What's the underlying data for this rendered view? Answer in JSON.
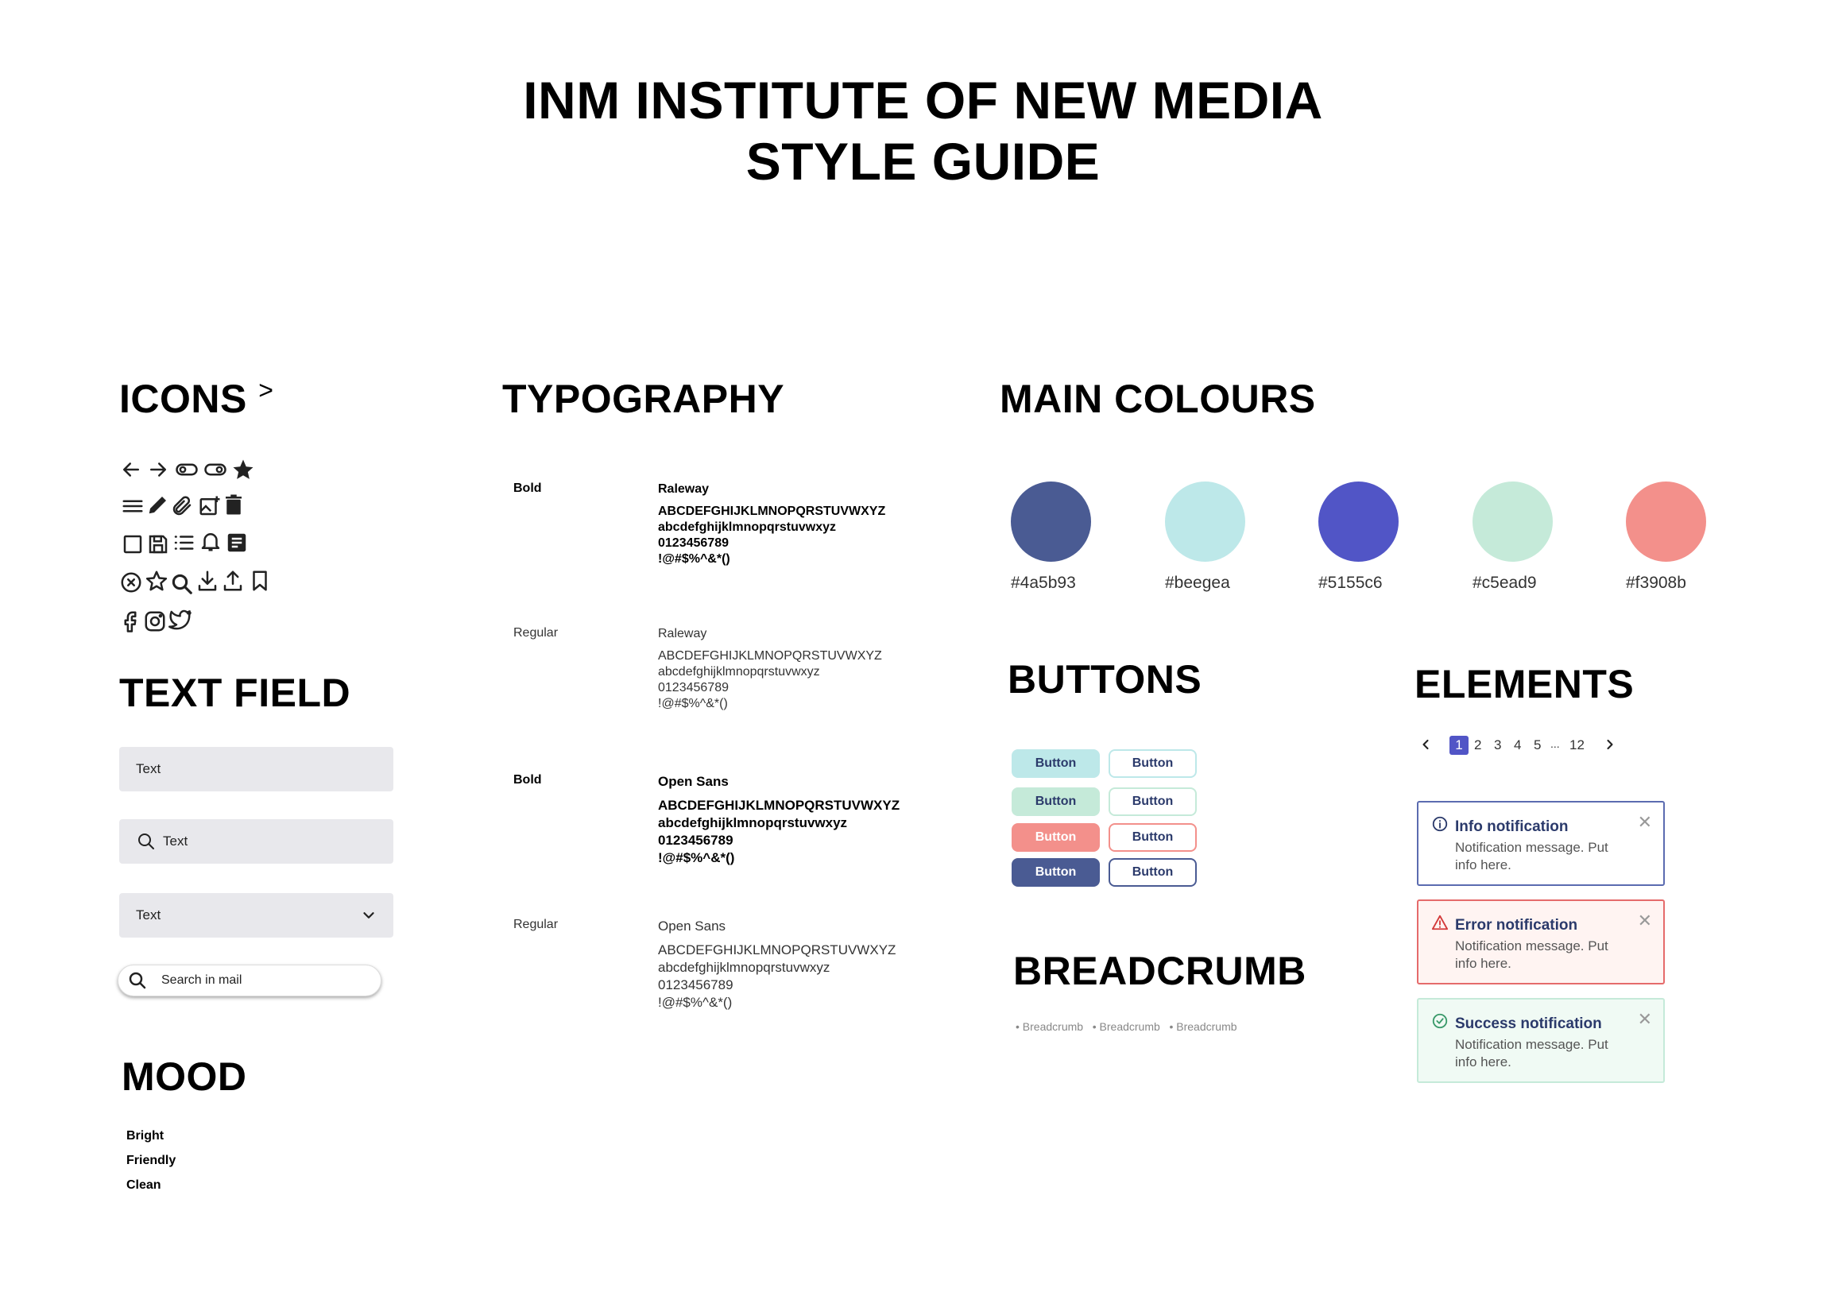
{
  "title": {
    "line1": "INM INSTITUTE OF NEW MEDIA",
    "line2": "STYLE GUIDE"
  },
  "icons": {
    "heading": "ICONS",
    "heading_suffix": ">",
    "rows": [
      [
        "arrow-left-icon",
        "arrow-right-icon",
        "toggle-off-icon",
        "toggle-on-icon",
        "star-filled-icon"
      ],
      [
        "menu-icon",
        "pencil-icon",
        "paperclip-icon",
        "add-image-icon",
        "trash-icon"
      ],
      [
        "checkbox-icon",
        "save-icon",
        "list-icon",
        "bell-icon",
        "notes-icon"
      ],
      [
        "close-circle-icon",
        "star-outline-icon",
        "search-icon",
        "download-icon",
        "upload-icon",
        "bookmark-icon"
      ],
      [
        "facebook-icon",
        "instagram-icon",
        "twitter-icon"
      ]
    ]
  },
  "text_field": {
    "heading": "TEXT FIELD",
    "plain_value": "Text",
    "search_value": "Text",
    "select_value": "Text",
    "mail_search_placeholder": "Search in mail"
  },
  "mood": {
    "heading": "MOOD",
    "items": [
      "Bright",
      "Friendly",
      "Clean"
    ]
  },
  "typography": {
    "heading": "TYPOGRAPHY",
    "samples": [
      {
        "weight": "Bold",
        "font": "Raleway",
        "upper": "ABCDEFGHIJKLMNOPQRSTUVWXYZ",
        "lower": "abcdefghijklmnopqrstuvwxyz",
        "digits": "0123456789",
        "symbols": "!@#$%^&*()"
      },
      {
        "weight": "Regular",
        "font": "Raleway",
        "upper": "ABCDEFGHIJKLMNOPQRSTUVWXYZ",
        "lower": "abcdefghijklmnopqrstuvwxyz",
        "digits": "0123456789",
        "symbols": "!@#$%^&*()"
      },
      {
        "weight": "Bold",
        "font": "Open Sans",
        "upper": "ABCDEFGHIJKLMNOPQRSTUVWXYZ",
        "lower": "abcdefghijklmnopqrstuvwxyz",
        "digits": "0123456789",
        "symbols": "!@#$%^&*()"
      },
      {
        "weight": "Regular",
        "font": "Open Sans",
        "upper": "ABCDEFGHIJKLMNOPQRSTUVWXYZ",
        "lower": "abcdefghijklmnopqrstuvwxyz",
        "digits": "0123456789",
        "symbols": "!@#$%^&*()"
      }
    ]
  },
  "colours": {
    "heading": "MAIN COLOURS",
    "swatches": [
      {
        "hex": "#4a5b93",
        "label": "#4a5b93"
      },
      {
        "hex": "#beegea",
        "css": "#bde8e9",
        "label": "#beegea"
      },
      {
        "hex": "#5155c6",
        "label": "#5155c6"
      },
      {
        "hex": "#c5ead9",
        "css": "#c5ead9",
        "label": "#c5ead9"
      },
      {
        "hex": "#f3908b",
        "label": "#f3908b"
      }
    ]
  },
  "buttons": {
    "heading": "BUTTONS",
    "label": "Button",
    "rows": [
      {
        "fill": "#bde8e9",
        "outline": "#bde8e9"
      },
      {
        "fill": "#c5ead9",
        "outline": "#c5ead9"
      },
      {
        "fill": "#f3908b",
        "outline": "#f3908b"
      },
      {
        "fill": "#4a5b93",
        "outline": "#4a5b93"
      }
    ]
  },
  "breadcrumb": {
    "heading": "BREADCRUMB",
    "items": [
      "Breadcrumb",
      "Breadcrumb",
      "Breadcrumb"
    ]
  },
  "elements": {
    "heading": "ELEMENTS",
    "pagination": {
      "pages": [
        "1",
        "2",
        "3",
        "4",
        "5",
        "...",
        "12"
      ],
      "active": "1",
      "accent": "#5155c6"
    },
    "notifications": [
      {
        "type": "info",
        "title": "Info notification",
        "message": "Notification message. Put info here.",
        "border": "#5b6bb0",
        "bg": "#ffffff"
      },
      {
        "type": "error",
        "title": "Error notification",
        "message": "Notification message. Put info here.",
        "border": "#e56b6b",
        "bg": "#fff4f2"
      },
      {
        "type": "success",
        "title": "Success notification",
        "message": "Notification message. Put info here.",
        "border": "#c5ead9",
        "bg": "#f0faf4"
      }
    ]
  }
}
